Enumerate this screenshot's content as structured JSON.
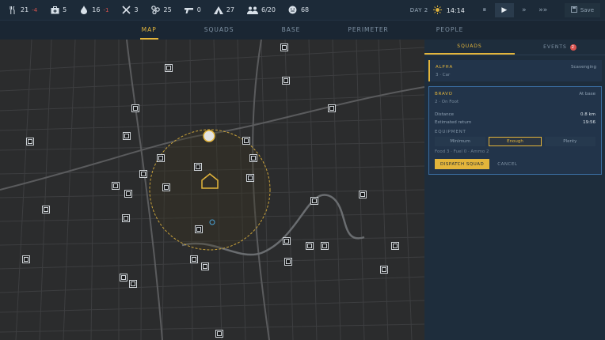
{
  "resources": [
    {
      "icon": "food-icon",
      "value": "21",
      "delta": "-4"
    },
    {
      "icon": "medkit-icon",
      "value": "5",
      "delta": ""
    },
    {
      "icon": "water-icon",
      "value": "16",
      "delta": "-1"
    },
    {
      "icon": "tools-icon",
      "value": "3",
      "delta": ""
    },
    {
      "icon": "parts-icon",
      "value": "25",
      "delta": ""
    },
    {
      "icon": "gun-icon",
      "value": "0",
      "delta": ""
    },
    {
      "icon": "tent-icon",
      "value": "27",
      "delta": ""
    },
    {
      "icon": "people-icon",
      "value": "6/20",
      "delta": ""
    },
    {
      "icon": "morale-icon",
      "value": "68",
      "delta": ""
    }
  ],
  "time": {
    "day": "DAY 2",
    "clock": "14:14"
  },
  "speed": {
    "pause": "⏸",
    "play": "▶",
    "fast": "»",
    "fastest": "»»"
  },
  "save_label": "Save",
  "nav": [
    "MAP",
    "SQUADS",
    "BASE",
    "PERIMETER",
    "PEOPLE"
  ],
  "panel": {
    "tabs": {
      "squads": "SQUADS",
      "events": "EVENTS",
      "events_count": "2"
    },
    "alpha": {
      "name": "ALPHA",
      "status": "Scavenging",
      "sub": "3 · Car"
    },
    "bravo": {
      "name": "BRAVO",
      "status": "At base",
      "sub": "2 · On Foot",
      "distance_label": "Distance",
      "distance": "0.8 km",
      "return_label": "Estimated return",
      "return": "19:56",
      "equipment_label": "EQUIPMENT",
      "options": [
        "Minimum",
        "Enough",
        "Plenty"
      ],
      "costs": "Food 3 · Fuel 0 · Ammo 2",
      "dispatch": "DISPATCH SQUAD",
      "cancel": "CANCEL"
    }
  },
  "colors": {
    "accent": "#e3b53b",
    "bg": "#1a2633",
    "alert": "#d9534f"
  }
}
